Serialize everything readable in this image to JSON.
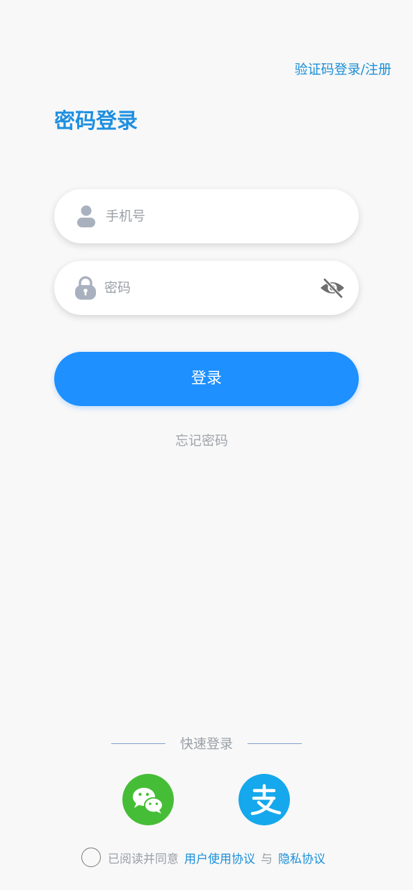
{
  "header": {
    "switch_link": "验证码登录/注册",
    "title": "密码登录"
  },
  "form": {
    "phone_placeholder": "手机号",
    "phone_value": "",
    "password_placeholder": "密码",
    "password_value": "",
    "login_label": "登录",
    "forgot_label": "忘记密码"
  },
  "quick_login": {
    "label": "快速登录",
    "providers": [
      {
        "name": "wechat",
        "icon": "wechat-icon",
        "color": "#46bd36"
      },
      {
        "name": "alipay",
        "icon": "alipay-icon",
        "color": "#15a8ec"
      }
    ]
  },
  "agreement": {
    "prefix": "已阅读并同意",
    "user_agreement": "用户使用协议",
    "conjunction": "与",
    "privacy_agreement": "隐私协议",
    "checked": false
  },
  "colors": {
    "accent": "#1e90ff",
    "link": "#1a8fd8",
    "background": "#f8f8f8"
  }
}
